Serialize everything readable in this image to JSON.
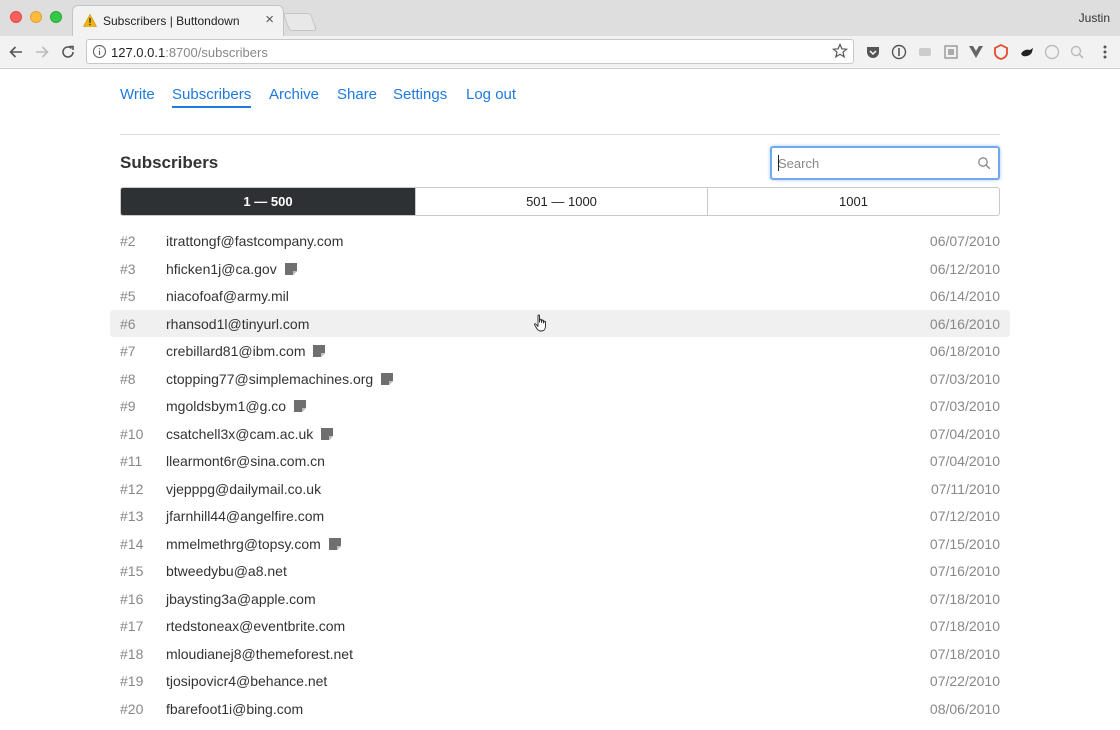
{
  "browser": {
    "tab_title": "Subscribers | Buttondown",
    "tab_close": "×",
    "user": "Justin",
    "url_host": "127.0.0.1",
    "url_rest": ":8700/subscribers"
  },
  "nav": {
    "items": [
      {
        "label": "Write"
      },
      {
        "label": "Subscribers"
      },
      {
        "label": "Archive"
      },
      {
        "label": "Share"
      },
      {
        "label": "Settings"
      },
      {
        "label": "Log out"
      }
    ],
    "active": "Subscribers"
  },
  "page": {
    "title": "Subscribers",
    "search_placeholder": "Search",
    "search_value": ""
  },
  "pagination": [
    {
      "label": "1 — 500",
      "active": true
    },
    {
      "label": "501 — 1000",
      "active": false
    },
    {
      "label": "1001",
      "active": false
    }
  ],
  "subscribers": [
    {
      "num": "#2",
      "email": "itrattongf@fastcompany.com",
      "has_note": false,
      "date": "06/07/2010"
    },
    {
      "num": "#3",
      "email": "hficken1j@ca.gov",
      "has_note": true,
      "date": "06/12/2010"
    },
    {
      "num": "#5",
      "email": "niacofoaf@army.mil",
      "has_note": false,
      "date": "06/14/2010"
    },
    {
      "num": "#6",
      "email": "rhansod1l@tinyurl.com",
      "has_note": false,
      "date": "06/16/2010"
    },
    {
      "num": "#7",
      "email": "crebillard81@ibm.com",
      "has_note": true,
      "date": "06/18/2010"
    },
    {
      "num": "#8",
      "email": "ctopping77@simplemachines.org",
      "has_note": true,
      "date": "07/03/2010"
    },
    {
      "num": "#9",
      "email": "mgoldsbym1@g.co",
      "has_note": true,
      "date": "07/03/2010"
    },
    {
      "num": "#10",
      "email": "csatchell3x@cam.ac.uk",
      "has_note": true,
      "date": "07/04/2010"
    },
    {
      "num": "#11",
      "email": "llearmont6r@sina.com.cn",
      "has_note": false,
      "date": "07/04/2010"
    },
    {
      "num": "#12",
      "email": "vjepppg@dailymail.co.uk",
      "has_note": false,
      "date": "07/11/2010"
    },
    {
      "num": "#13",
      "email": "jfarnhill44@angelfire.com",
      "has_note": false,
      "date": "07/12/2010"
    },
    {
      "num": "#14",
      "email": "mmelmethrg@topsy.com",
      "has_note": true,
      "date": "07/15/2010"
    },
    {
      "num": "#15",
      "email": "btweedybu@a8.net",
      "has_note": false,
      "date": "07/16/2010"
    },
    {
      "num": "#16",
      "email": "jbaysting3a@apple.com",
      "has_note": false,
      "date": "07/18/2010"
    },
    {
      "num": "#17",
      "email": "rtedstoneax@eventbrite.com",
      "has_note": false,
      "date": "07/18/2010"
    },
    {
      "num": "#18",
      "email": "mloudianej8@themeforest.net",
      "has_note": false,
      "date": "07/18/2010"
    },
    {
      "num": "#19",
      "email": "tjosipovicr4@behance.net",
      "has_note": false,
      "date": "07/22/2010"
    },
    {
      "num": "#20",
      "email": "fbarefoot1i@bing.com",
      "has_note": false,
      "date": "08/06/2010"
    }
  ],
  "hovered_row": "#6",
  "colors": {
    "link": "#1f7ae0",
    "active_segment": "#2e3133",
    "focus_ring": "#73a8ec",
    "hover_row": "#f0f0f0"
  }
}
